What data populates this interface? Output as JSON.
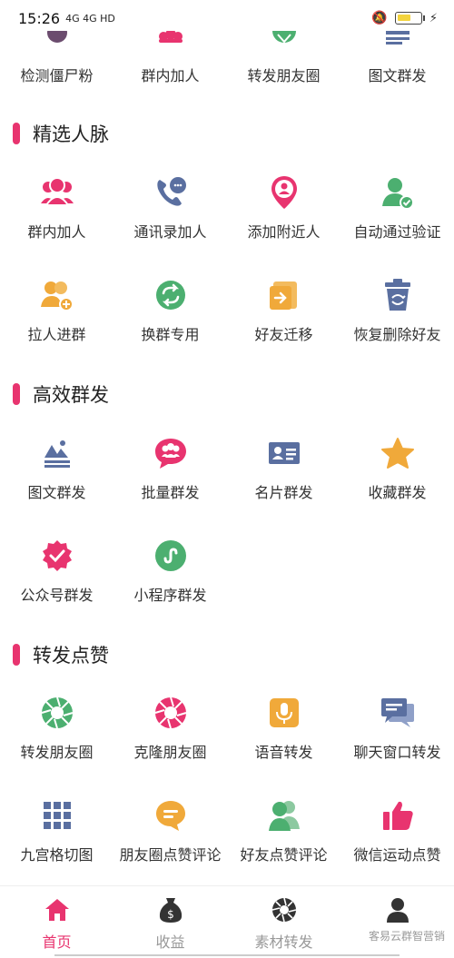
{
  "status_bar": {
    "time": "15:26",
    "network": "4G 4G HD",
    "battery_level": 0.6,
    "icons": [
      "mute-icon",
      "battery-icon",
      "charging-icon"
    ]
  },
  "top_row": [
    {
      "label": "检测僵尸粉",
      "icon": "magnifier-icon",
      "color": "#6b4c6e"
    },
    {
      "label": "群内加人",
      "icon": "group-icon",
      "color": "#e8346f"
    },
    {
      "label": "转发朋友圈",
      "icon": "aperture-icon",
      "color": "#4caf70"
    },
    {
      "label": "图文群发",
      "icon": "document-icon",
      "color": "#5a6fa0"
    }
  ],
  "sections": [
    {
      "title": "精选人脉",
      "items": [
        {
          "label": "群内加人",
          "icon": "group-icon",
          "color": "#e8346f"
        },
        {
          "label": "通讯录加人",
          "icon": "phone-chat-icon",
          "color": "#5a6fa0"
        },
        {
          "label": "添加附近人",
          "icon": "location-person-icon",
          "color": "#e8346f"
        },
        {
          "label": "自动通过验证",
          "icon": "user-check-icon",
          "color": "#4caf70"
        },
        {
          "label": "拉人进群",
          "icon": "group-add-icon",
          "color": "#f0a93a"
        },
        {
          "label": "换群专用",
          "icon": "swap-icon",
          "color": "#4caf70"
        },
        {
          "label": "好友迁移",
          "icon": "transfer-icon",
          "color": "#f0a93a"
        },
        {
          "label": "恢复删除好友",
          "icon": "trash-restore-icon",
          "color": "#5a6fa0"
        }
      ]
    },
    {
      "title": "高效群发",
      "items": [
        {
          "label": "图文群发",
          "icon": "image-text-icon",
          "color": "#5a6fa0"
        },
        {
          "label": "批量群发",
          "icon": "bubble-group-icon",
          "color": "#e8346f"
        },
        {
          "label": "名片群发",
          "icon": "card-icon",
          "color": "#5a6fa0"
        },
        {
          "label": "收藏群发",
          "icon": "star-icon",
          "color": "#f0a93a"
        },
        {
          "label": "公众号群发",
          "icon": "badge-check-icon",
          "color": "#e8346f"
        },
        {
          "label": "小程序群发",
          "icon": "mini-program-icon",
          "color": "#4caf70"
        }
      ]
    },
    {
      "title": "转发点赞",
      "items": [
        {
          "label": "转发朋友圈",
          "icon": "aperture-icon",
          "color": "#4caf70"
        },
        {
          "label": "克隆朋友圈",
          "icon": "aperture-icon",
          "color": "#e8346f"
        },
        {
          "label": "语音转发",
          "icon": "microphone-icon",
          "color": "#f0a93a"
        },
        {
          "label": "聊天窗口转发",
          "icon": "chat-bubbles-icon",
          "color": "#5a6fa0"
        },
        {
          "label": "九宫格切图",
          "icon": "grid-icon",
          "color": "#5a6fa0"
        },
        {
          "label": "朋友圈点赞评论",
          "icon": "comment-icon",
          "color": "#f0a93a"
        },
        {
          "label": "好友点赞评论",
          "icon": "users-icon",
          "color": "#4caf70"
        },
        {
          "label": "微信运动点赞",
          "icon": "thumbs-up-icon",
          "color": "#e8346f"
        }
      ]
    }
  ],
  "tabs": [
    {
      "label": "首页",
      "icon": "home-icon",
      "active": true
    },
    {
      "label": "收益",
      "icon": "money-bag-icon",
      "active": false
    },
    {
      "label": "素材转发",
      "icon": "aperture-icon",
      "active": false
    },
    {
      "label": "",
      "icon": "person-icon",
      "active": false
    }
  ],
  "watermark": "客易云群智营销",
  "colors": {
    "accent": "#e8346f",
    "green": "#4caf70",
    "blue": "#5a6fa0",
    "orange": "#f0a93a"
  }
}
